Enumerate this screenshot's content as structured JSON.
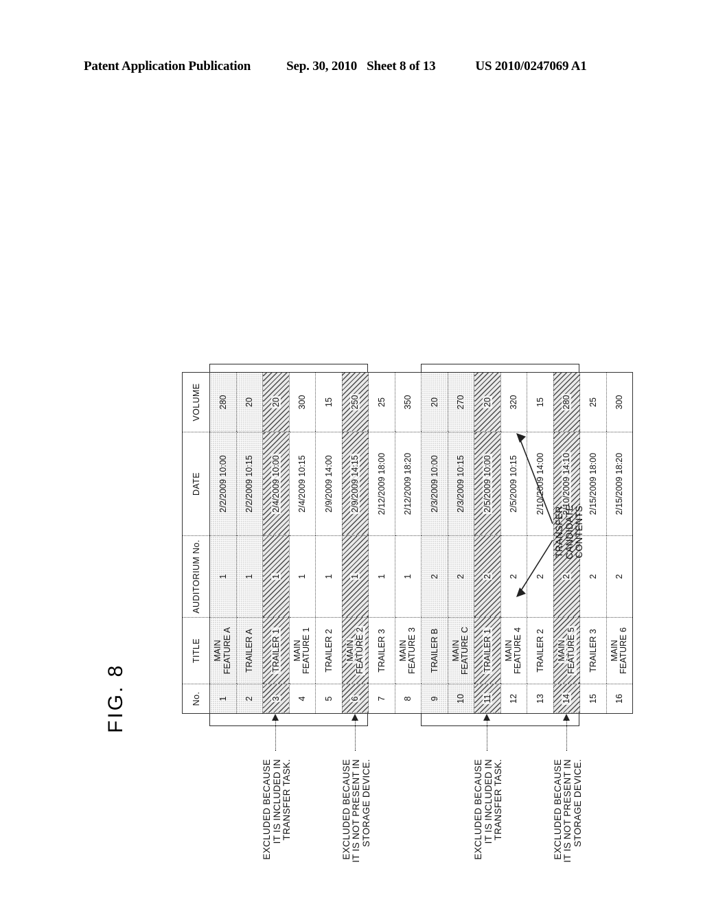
{
  "header": {
    "publication": "Patent Application Publication",
    "date": "Sep. 30, 2010",
    "sheet": "Sheet 8 of 13",
    "document_number": "US 2010/0247069 A1"
  },
  "figure": {
    "label": "FIG. 8",
    "transfer_candidate_label_line1": "TRANSFER",
    "transfer_candidate_label_line2": "CANDIDATE",
    "transfer_candidate_label_line3": "CONTENTS"
  },
  "callouts": [
    {
      "id": "callout-1",
      "line1": "EXCLUDED BECAUSE",
      "line2": "IT IS INCLUDED IN",
      "line3": "TRANSFER TASK.",
      "target_row": 3
    },
    {
      "id": "callout-2",
      "line1": "EXCLUDED BECAUSE",
      "line2": "IT IS NOT PRESENT IN",
      "line3": "STORAGE DEVICE.",
      "target_row": 6
    },
    {
      "id": "callout-3",
      "line1": "EXCLUDED BECAUSE",
      "line2": "IT IS INCLUDED IN",
      "line3": "TRANSFER TASK.",
      "target_row": 11
    },
    {
      "id": "callout-4",
      "line1": "EXCLUDED BECAUSE",
      "line2": "IT IS NOT PRESENT IN",
      "line3": "STORAGE DEVICE.",
      "target_row": 14
    }
  ],
  "table": {
    "columns": [
      "No.",
      "TITLE",
      "AUDITORIUM No.",
      "DATE",
      "VOLUME"
    ],
    "rows": [
      {
        "no": "1",
        "title_l1": "MAIN",
        "title_l2": "FEATURE A",
        "auditorium": "1",
        "date": "2/2/2009 10:00",
        "volume": "280",
        "shading": "dot"
      },
      {
        "no": "2",
        "title_l1": "TRAILER A",
        "title_l2": "",
        "auditorium": "1",
        "date": "2/2/2009 10:15",
        "volume": "20",
        "shading": "dot"
      },
      {
        "no": "3",
        "title_l1": "TRAILER 1",
        "title_l2": "",
        "auditorium": "1",
        "date": "2/4/2009 10:00",
        "volume": "20",
        "shading": "hatch"
      },
      {
        "no": "4",
        "title_l1": "MAIN",
        "title_l2": "FEATURE 1",
        "auditorium": "1",
        "date": "2/4/2009 10:15",
        "volume": "300",
        "shading": "none"
      },
      {
        "no": "5",
        "title_l1": "TRAILER 2",
        "title_l2": "",
        "auditorium": "1",
        "date": "2/9/2009 14:00",
        "volume": "15",
        "shading": "none"
      },
      {
        "no": "6",
        "title_l1": "MAIN",
        "title_l2": "FEATURE 2",
        "auditorium": "1",
        "date": "2/9/2009 14:15",
        "volume": "250",
        "shading": "hatch"
      },
      {
        "no": "7",
        "title_l1": "TRAILER 3",
        "title_l2": "",
        "auditorium": "1",
        "date": "2/12/2009 18:00",
        "volume": "25",
        "shading": "none"
      },
      {
        "no": "8",
        "title_l1": "MAIN",
        "title_l2": "FEATURE 3",
        "auditorium": "1",
        "date": "2/12/2009 18:20",
        "volume": "350",
        "shading": "none"
      },
      {
        "no": "9",
        "title_l1": "TRAILER B",
        "title_l2": "",
        "auditorium": "2",
        "date": "2/3/2009 10:00",
        "volume": "20",
        "shading": "dot"
      },
      {
        "no": "10",
        "title_l1": "MAIN",
        "title_l2": "FEATURE C",
        "auditorium": "2",
        "date": "2/3/2009 10:15",
        "volume": "270",
        "shading": "dot"
      },
      {
        "no": "11",
        "title_l1": "TRAILER 1",
        "title_l2": "",
        "auditorium": "2",
        "date": "2/5/2009 10:00",
        "volume": "20",
        "shading": "hatch"
      },
      {
        "no": "12",
        "title_l1": "MAIN",
        "title_l2": "FEATURE 4",
        "auditorium": "2",
        "date": "2/5/2009 10:15",
        "volume": "320",
        "shading": "none"
      },
      {
        "no": "13",
        "title_l1": "TRAILER 2",
        "title_l2": "",
        "auditorium": "2",
        "date": "2/10/2009 14:00",
        "volume": "15",
        "shading": "none"
      },
      {
        "no": "14",
        "title_l1": "MAIN",
        "title_l2": "FEATURE 5",
        "auditorium": "2",
        "date": "2/10/2009 14:10",
        "volume": "280",
        "shading": "hatch"
      },
      {
        "no": "15",
        "title_l1": "TRAILER 3",
        "title_l2": "",
        "auditorium": "2",
        "date": "2/15/2009 18:00",
        "volume": "25",
        "shading": "none"
      },
      {
        "no": "16",
        "title_l1": "MAIN",
        "title_l2": "FEATURE 6",
        "auditorium": "2",
        "date": "2/15/2009 18:20",
        "volume": "300",
        "shading": "none"
      }
    ],
    "bracket_groups": [
      {
        "id": "group-auditorium-1",
        "first_row": 1,
        "last_row": 6
      },
      {
        "id": "group-auditorium-2",
        "first_row": 9,
        "last_row": 14
      }
    ]
  }
}
